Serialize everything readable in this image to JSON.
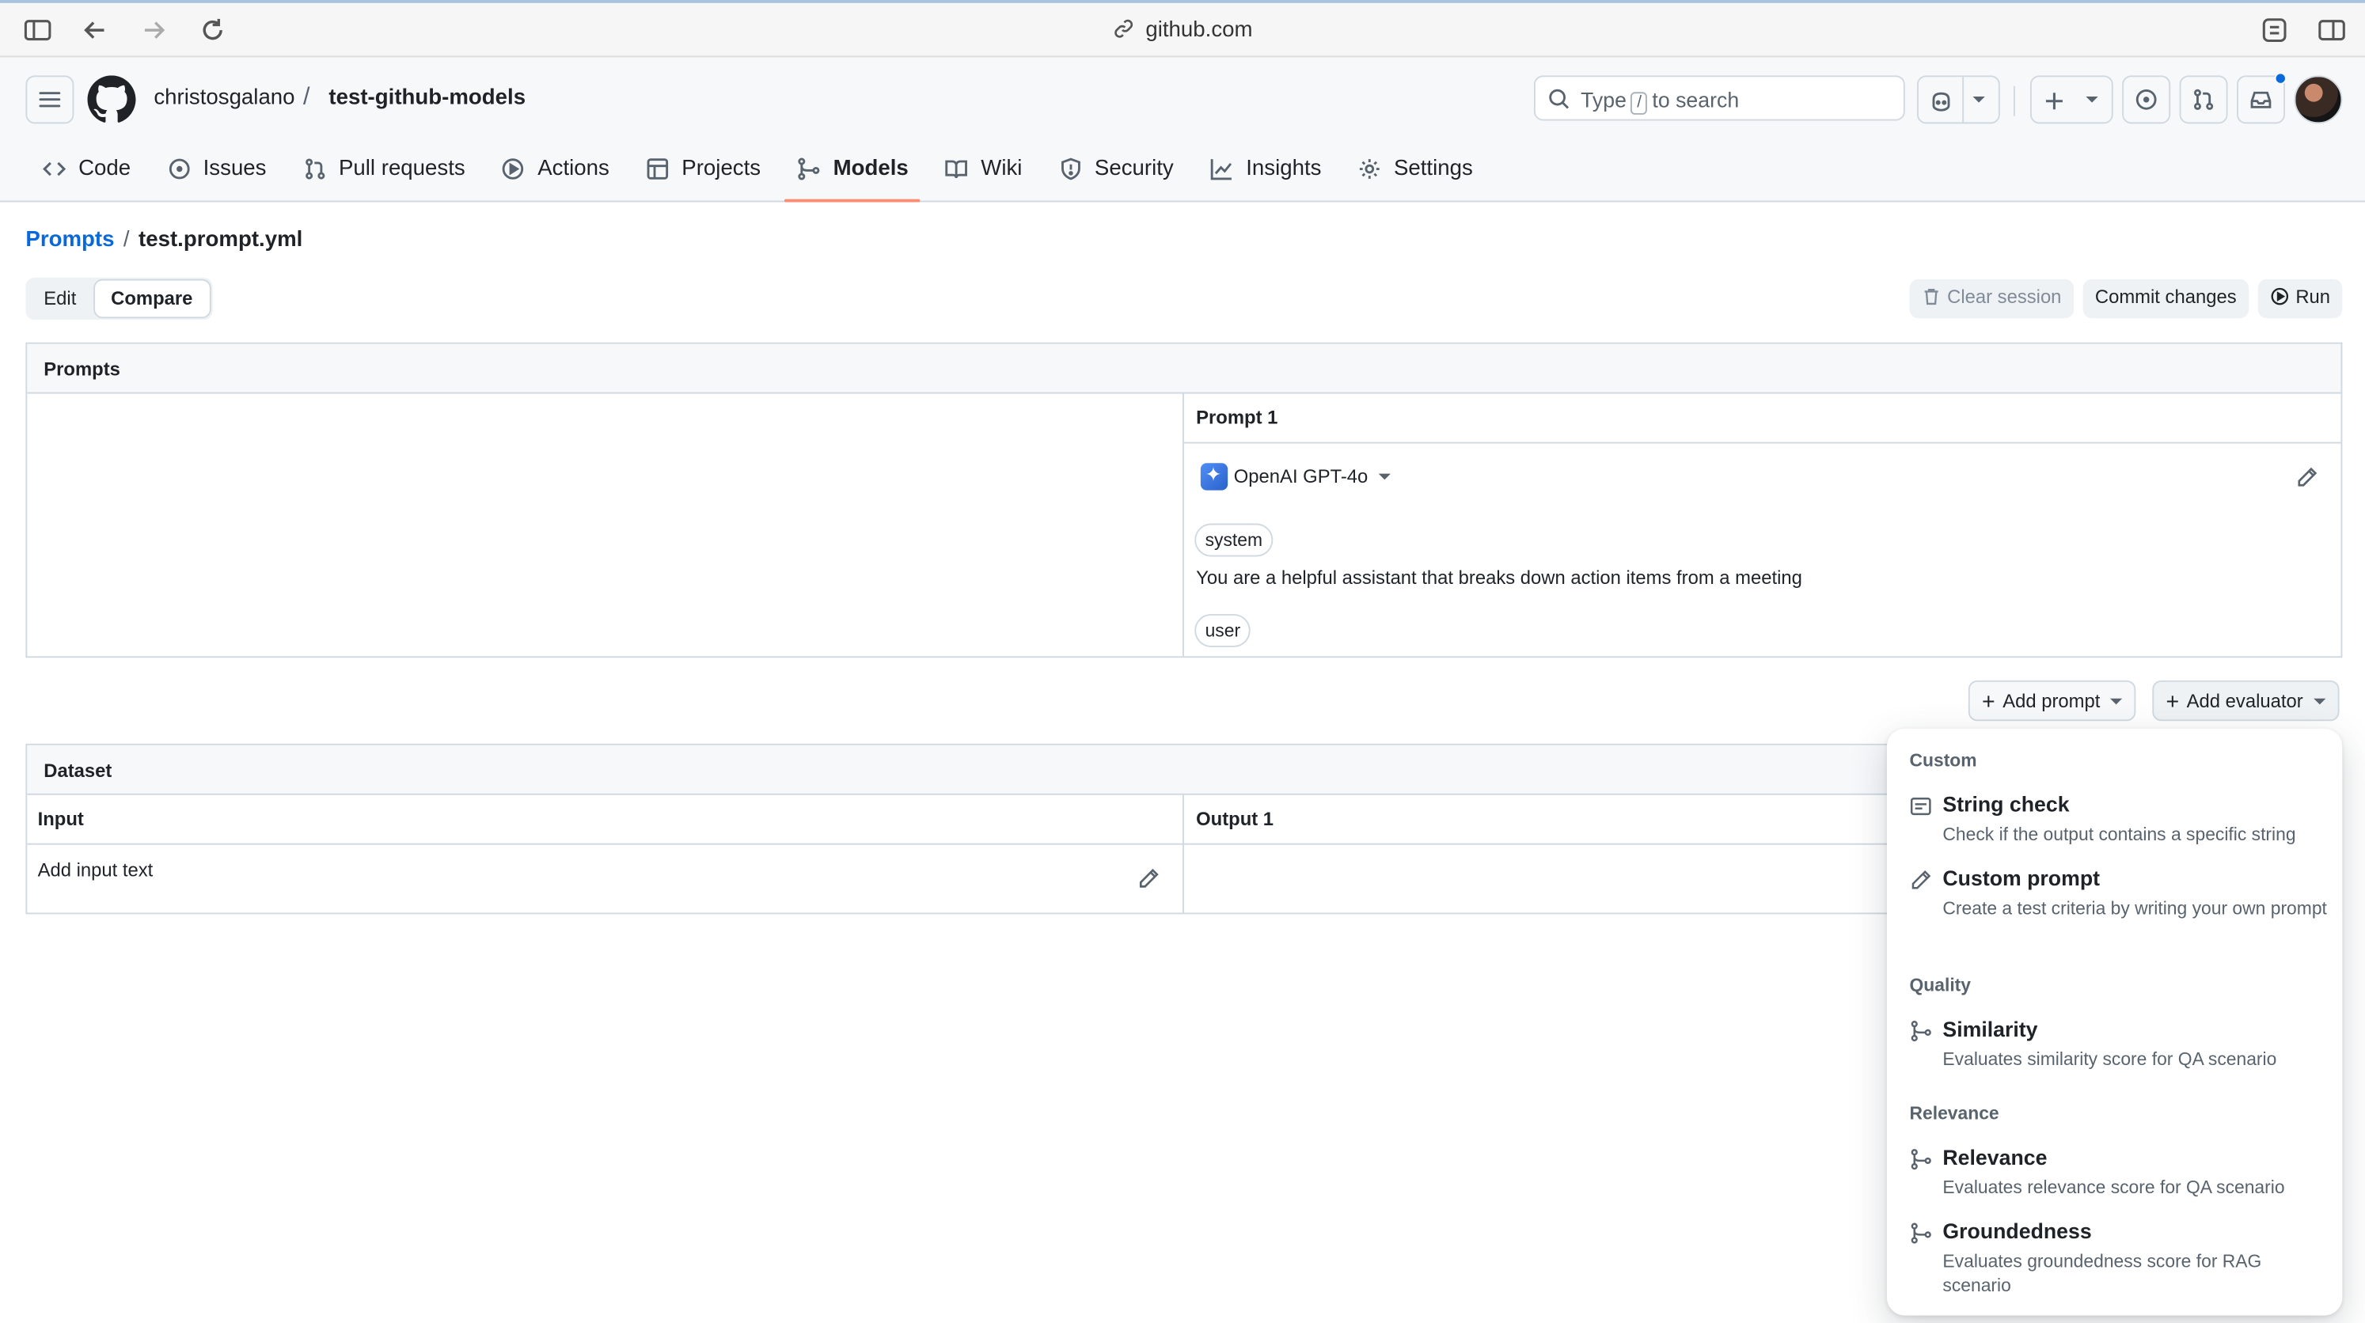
{
  "browser": {
    "url": "github.com"
  },
  "header": {
    "owner": "christosgalano",
    "separator": "/",
    "repo": "test-github-models",
    "search": {
      "prefix": "Type",
      "key": "/",
      "suffix": "to search"
    }
  },
  "nav": {
    "tabs": [
      {
        "label": "Code",
        "icon": "code-icon"
      },
      {
        "label": "Issues",
        "icon": "issue-icon"
      },
      {
        "label": "Pull requests",
        "icon": "pull-request-icon"
      },
      {
        "label": "Actions",
        "icon": "play-icon"
      },
      {
        "label": "Projects",
        "icon": "table-icon"
      },
      {
        "label": "Models",
        "icon": "models-icon",
        "active": true
      },
      {
        "label": "Wiki",
        "icon": "book-icon"
      },
      {
        "label": "Security",
        "icon": "shield-icon"
      },
      {
        "label": "Insights",
        "icon": "graph-icon"
      },
      {
        "label": "Settings",
        "icon": "gear-icon"
      }
    ]
  },
  "breadcrumb": {
    "root": "Prompts",
    "sep": "/",
    "file": "test.prompt.yml"
  },
  "mode": {
    "edit": "Edit",
    "compare": "Compare",
    "selected": "Compare"
  },
  "actions": {
    "clear": "Clear session",
    "commit": "Commit changes",
    "run": "Run"
  },
  "prompts_panel": {
    "title": "Prompts",
    "column": "Prompt 1",
    "model": "OpenAI GPT-4o",
    "system_role": "system",
    "system_text": "You are a helpful assistant that breaks down action items from a meeting",
    "user_role": "user"
  },
  "add": {
    "prompt": "Add prompt",
    "evaluator": "Add evaluator"
  },
  "dataset": {
    "title": "Dataset",
    "input_header": "Input",
    "output_header": "Output 1",
    "input_placeholder": "Add input text"
  },
  "evaluator_menu": {
    "groups": [
      {
        "label": "Custom",
        "items": [
          {
            "title": "String check",
            "desc": "Check if the output contains a specific string",
            "icon": "note-icon"
          },
          {
            "title": "Custom prompt",
            "desc": "Create a test criteria by writing your own prompt",
            "icon": "pencil-icon"
          }
        ]
      },
      {
        "label": "Quality",
        "items": [
          {
            "title": "Similarity",
            "desc": "Evaluates similarity score for QA scenario",
            "icon": "models-icon"
          }
        ]
      },
      {
        "label": "Relevance",
        "items": [
          {
            "title": "Relevance",
            "desc": "Evaluates relevance score for QA scenario",
            "icon": "models-icon"
          },
          {
            "title": "Groundedness",
            "desc": "Evaluates groundedness score for RAG scenario",
            "icon": "models-icon"
          }
        ]
      }
    ]
  },
  "colors": {
    "accent": "#0969da",
    "tab_underline": "#fd8c73",
    "border": "#d1d9e0"
  }
}
